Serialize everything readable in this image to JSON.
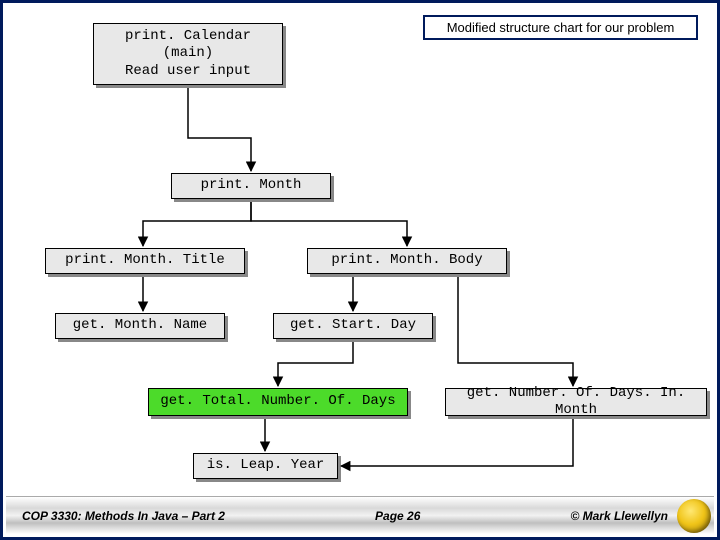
{
  "caption": "Modified structure chart for our problem",
  "nodes": {
    "root_l1": "print. Calendar",
    "root_l2": "(main)",
    "root_l3": "Read user input",
    "printMonth": "print. Month",
    "printMonthTitle": "print. Month. Title",
    "printMonthBody": "print. Month. Body",
    "getMonthName": "get. Month. Name",
    "getStartDay": "get. Start. Day",
    "getTotalDays": "get. Total. Number. Of. Days",
    "getDaysInMonth": "get. Number. Of. Days. In. Month",
    "isLeapYear": "is. Leap. Year"
  },
  "footer": {
    "left": "COP 3330: Methods In Java – Part 2",
    "center": "Page 26",
    "right": "© Mark Llewellyn"
  }
}
